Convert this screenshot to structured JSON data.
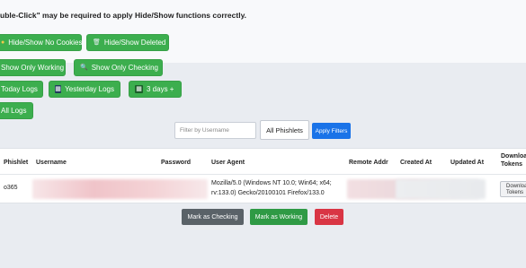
{
  "notice": {
    "text": "uble-Click\" may be required to apply Hide/Show functions correctly."
  },
  "buttons": {
    "hide_no_cookies": "Hide/Show No Cookies",
    "hide_deleted": "Hide/Show Deleted",
    "show_only_working": "Show Only Working",
    "show_only_checking": "Show Only Checking",
    "today_logs": "Today Logs",
    "yesterday_logs": "Yesterday Logs",
    "three_days": "3 days +",
    "all_logs": "All Logs"
  },
  "filters": {
    "username_placeholder": "Filter by Username",
    "phishlet_select": "All Phishlets",
    "apply": "Apply Filters"
  },
  "table": {
    "headers": {
      "phishlet": "Phishlet",
      "username": "Username",
      "password": "Password",
      "user_agent": "User Agent",
      "remote_addr": "Remote Addr",
      "created_at": "Created At",
      "updated_at": "Updated At",
      "download_tokens": "Download Tokens"
    },
    "rows": [
      {
        "phishlet": "o365",
        "user_agent_line1": "Mozilla/5.0 (Windows NT 10.0; Win64; x64;",
        "user_agent_line2": "rv:133.0) Gecko/20100101 Firefox/133.0",
        "download_label": "Download Tokens"
      }
    ]
  },
  "actions": {
    "mark_checking": "Mark as Checking",
    "mark_working": "Mark as Working",
    "delete": "Delete"
  },
  "colors": {
    "green": "#3cae4e",
    "blue": "#1a73e8",
    "grey": "#5a6268",
    "red": "#d93544"
  }
}
